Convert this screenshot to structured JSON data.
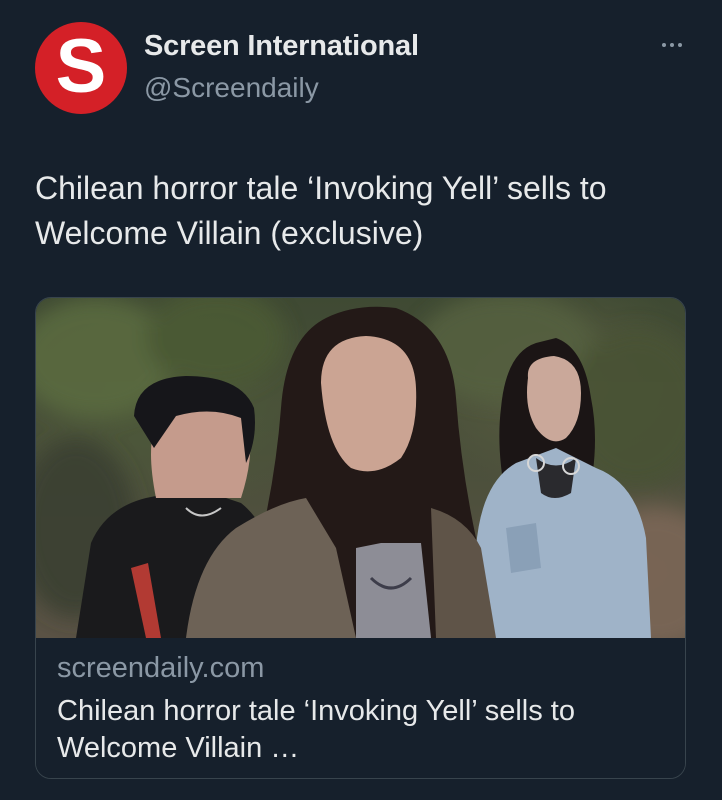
{
  "account": {
    "avatar_letter": "S",
    "display_name": "Screen International",
    "handle": "@Screendaily"
  },
  "tweet": {
    "text": "Chilean horror tale ‘Invoking Yell’ sells to Welcome Villain (exclusive)"
  },
  "card": {
    "image_alt": "Three women with long dark hair standing outdoors in a forest",
    "domain": "screendaily.com",
    "title": "Chilean horror tale ‘Invoking Yell’ sells to Welcome Villain …"
  },
  "icons": {
    "more": "more-dots-icon"
  },
  "colors": {
    "background": "#16202c",
    "primary_text": "#e7e9ea",
    "secondary_text": "#8b98a5",
    "card_border": "#38444d",
    "avatar_red": "#d42027"
  }
}
